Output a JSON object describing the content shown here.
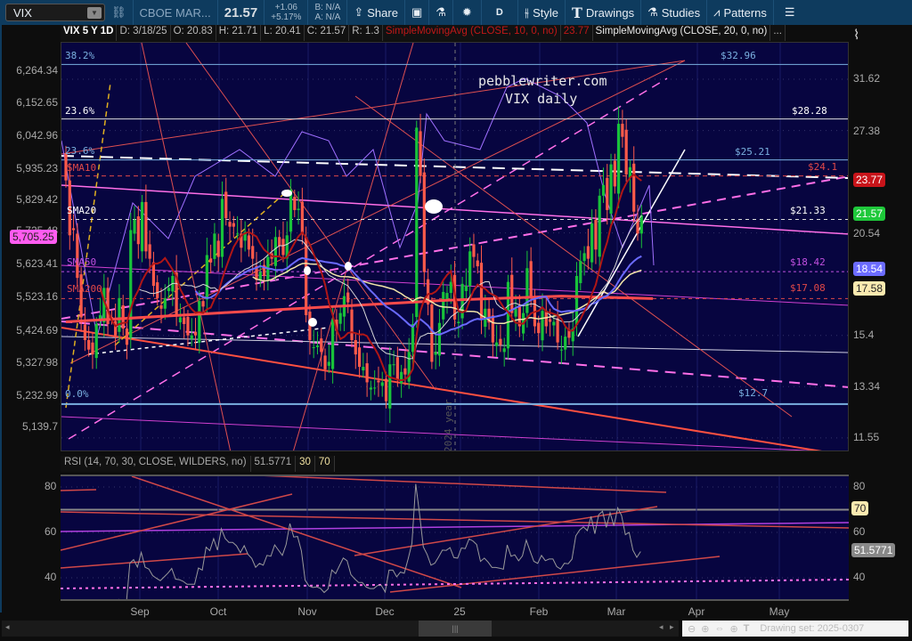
{
  "toolbar": {
    "symbol": "VIX",
    "description": "CBOE MAR...",
    "last": "21.57",
    "change": "+1.06",
    "change_pct": "+5.17%",
    "bid": "B: N/A",
    "ask": "A: N/A",
    "share": "Share",
    "aggregation": "D",
    "style": "Style",
    "drawings": "Drawings",
    "studies": "Studies",
    "patterns": "Patterns"
  },
  "header": {
    "title": "VIX 5 Y 1D",
    "date": "D: 3/18/25",
    "open": "O: 20.83",
    "high": "H: 21.71",
    "low": "L: 20.41",
    "close": "C: 21.57",
    "range": "R: 1.3",
    "sma10": "SimpleMovingAvg (CLOSE, 10, 0, no)",
    "sma10_value": "23.77",
    "sma20": "SimpleMovingAvg (CLOSE, 20, 0, no)",
    "more": "..."
  },
  "left_axis": [
    "6,264.34",
    "6,152.65",
    "6,042.96",
    "5,935.23",
    "5,829.42",
    "5,725.48",
    "5,623.41",
    "5,523.16",
    "5,424.69",
    "5,327.98",
    "5,232.99",
    "5,139.7"
  ],
  "left_tag": "5,705.25",
  "right_axis": [
    "31.62",
    "27.38",
    "20.54",
    "15.4",
    "13.34",
    "11.55"
  ],
  "price_tags": {
    "sma10": "23.77",
    "last": "21.57",
    "sma50": "18.54",
    "sma100": "17.58"
  },
  "colors": {
    "bg": "#070540",
    "up": "#18c23a",
    "down": "#ff5a4a",
    "sma10": "#b01616",
    "sma20": "#d8d8d8",
    "sma50": "#6a6aff",
    "sma100": "#f2e6a8",
    "sma200": "#ff4b4b",
    "rsi": "#9a9a9a"
  },
  "fib_labels": {
    "f382": "38.2%",
    "f236a": "23.6%",
    "f236b": "23.6%",
    "f0": "0.0%"
  },
  "level_labels": {
    "l3296": "$32.96",
    "l2828": "$28.28",
    "l2521": "$25.21",
    "l241": "$24.1",
    "l2133": "$21.33",
    "l1842": "$18.42",
    "l1708": "$17.08",
    "l127": "$12.7"
  },
  "sma_labels": {
    "s10": "SMA10",
    "s20": "SMA20",
    "s50": "SMA50",
    "s200": "SMA200"
  },
  "watermark": {
    "line1": "pebblewriter.com",
    "line2": "VIX daily",
    "year": "2024 year"
  },
  "rsi": {
    "header": "RSI (14, 70, 30, CLOSE, WILDERS, no)",
    "value": "51.5771",
    "os": "30",
    "ob": "70",
    "axis": [
      "80",
      "60",
      "40"
    ],
    "tag70": "70"
  },
  "months": [
    "Sep",
    "Oct",
    "Nov",
    "Dec",
    "25",
    "Feb",
    "Mar",
    "Apr",
    "May"
  ],
  "bottom": {
    "drawing_set": "Drawing set: 2025-0307"
  },
  "chart_data": {
    "type": "candlestick",
    "title": "VIX 5 Y 1D",
    "start_date": "2024-08-08",
    "end_date": "2025-03-18",
    "scale": "log",
    "ylim": [
      10.9,
      35.5
    ],
    "closes": [
      23.8,
      20.4,
      20.7,
      18.1,
      16.2,
      15.2,
      14.8,
      14.6,
      15.9,
      16.3,
      17.6,
      15.9,
      16.2,
      15.4,
      17.1,
      15.7,
      15.0,
      20.7,
      21.3,
      19.9,
      22.4,
      19.5,
      19.1,
      17.7,
      17.1,
      16.6,
      17.1,
      17.6,
      18.2,
      16.3,
      16.2,
      15.9,
      15.4,
      15.4,
      15.4,
      16.96,
      16.7,
      19.3,
      18.9,
      20.5,
      19.2,
      22.6,
      21.4,
      20.9,
      20.9,
      20.5,
      19.7,
      20.6,
      19.6,
      19.1,
      18.0,
      18.4,
      18.2,
      19.2,
      19.1,
      20.3,
      19.8,
      19.3,
      20.4,
      23.2,
      21.9,
      21.98,
      20.5,
      16.3,
      15.2,
      14.9,
      14.97,
      14.7,
      14.0,
      14.3,
      16.1,
      15.6,
      16.4,
      17.2,
      16.9,
      15.2,
      14.6,
      14.1,
      14.1,
      13.5,
      13.3,
      13.3,
      13.5,
      13.5,
      12.8,
      14.2,
      14.2,
      13.6,
      13.9,
      13.8,
      14.7,
      15.9,
      27.6,
      24.1,
      18.4,
      16.8,
      14.3,
      14.7,
      15.95,
      17.4,
      17.35,
      17.9,
      16.1,
      16.0,
      17.8,
      17.7,
      19.5,
      19.2,
      18.7,
      16.1,
      16.6,
      15.97,
      15.1,
      15.1,
      15.0,
      14.85,
      17.9,
      16.4,
      16.6,
      15.8,
      16.4,
      18.6,
      17.2,
      15.8,
      15.5,
      16.5,
      15.8,
      16.0,
      16.0,
      15.1,
      14.8,
      15.35,
      15.3,
      15.7,
      18.2,
      18.98,
      19.4,
      19.1,
      21.1,
      19.6,
      22.8,
      23.5,
      21.9,
      24.9,
      23.4,
      27.9,
      26.9,
      24.2,
      24.7,
      21.8,
      20.5,
      21.57
    ],
    "sma200_approx": [
      [
        0,
        16.0
      ],
      [
        40,
        16.4
      ],
      [
        80,
        16.8
      ],
      [
        100,
        17.0
      ],
      [
        130,
        17.2
      ],
      [
        154,
        17.08
      ]
    ],
    "levels": [
      32.96,
      28.28,
      25.21,
      24.1,
      21.33,
      18.42,
      17.08,
      12.7
    ],
    "rsi_period": 14,
    "rsi_ylim": [
      26,
      88
    ]
  }
}
